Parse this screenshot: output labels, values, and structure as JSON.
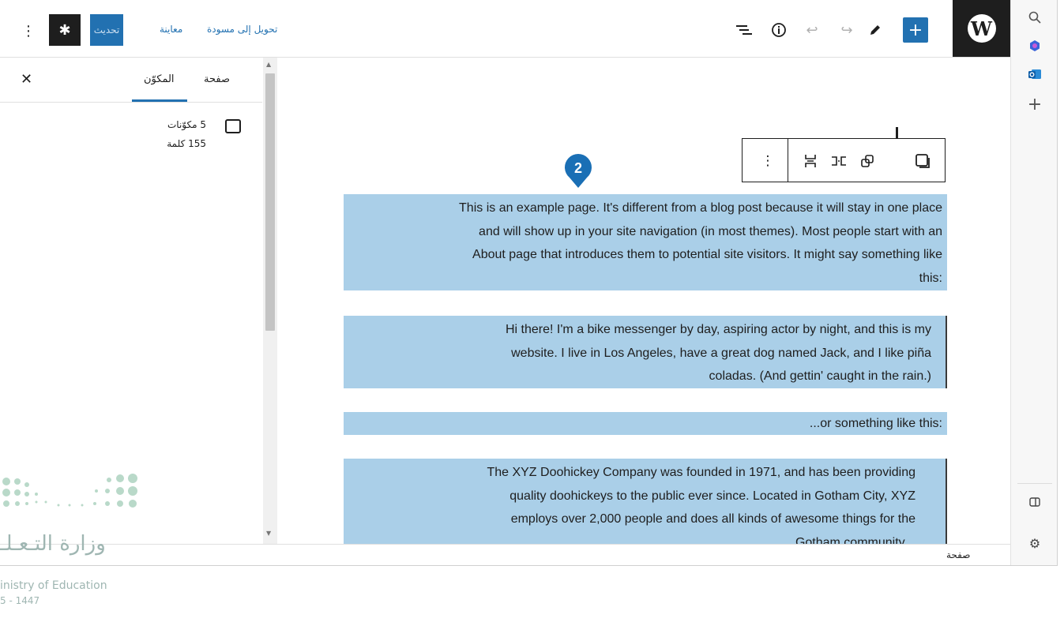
{
  "browser_sidebar": {
    "icons": [
      "search-icon",
      "copilot-icon",
      "outlook-icon",
      "plus-icon",
      "split-panel-icon",
      "settings-gear-icon"
    ]
  },
  "topbar": {
    "logo_letter": "W",
    "switch_to_draft_label": "تحويل إلى مسودة",
    "preview_label": "معاينة",
    "update_label": "تحديث",
    "add_label": "+",
    "accent_color": "#2271b1"
  },
  "settings_panel": {
    "tab_page": "صفحة",
    "tab_block": "المكوّن",
    "close_label": "✕",
    "blocks_count": "5 مكوّنات",
    "words_count": "155 كلمة"
  },
  "block_toolbar": {
    "more_label": "⋮"
  },
  "marker": {
    "number": "2",
    "color": "#1a6fb5"
  },
  "content": {
    "paragraphs": [
      [
        "This is an example page. It's different from a blog post because it will stay in one place",
        "and will show up in your site navigation (in most themes). Most people start with an",
        "About page that introduces them to potential site visitors. It might say something like",
        ":this"
      ],
      [
        "Hi there! I'm a bike messenger by day, aspiring actor by night, and this is my",
        "website. I live in Los Angeles, have a great dog named Jack, and I like piña",
        "coladas. (And gettin' caught in the rain.)"
      ],
      [
        ":or something like this..."
      ],
      [
        "The XYZ Doohickey Company was founded in 1971, and has been providing",
        "quality doohickeys to the public ever since. Located in Gotham City, XYZ",
        "employs over 2,000 people and does all kinds of awesome things for the",
        "...Gotham community"
      ]
    ],
    "highlight_color": "#aacfe8"
  },
  "statusbar": {
    "crumb": "صفحة"
  },
  "watermark": {
    "arabic": "وزارة التـعـلـ",
    "english": "inistry of Education",
    "year": "5 - 1447"
  }
}
